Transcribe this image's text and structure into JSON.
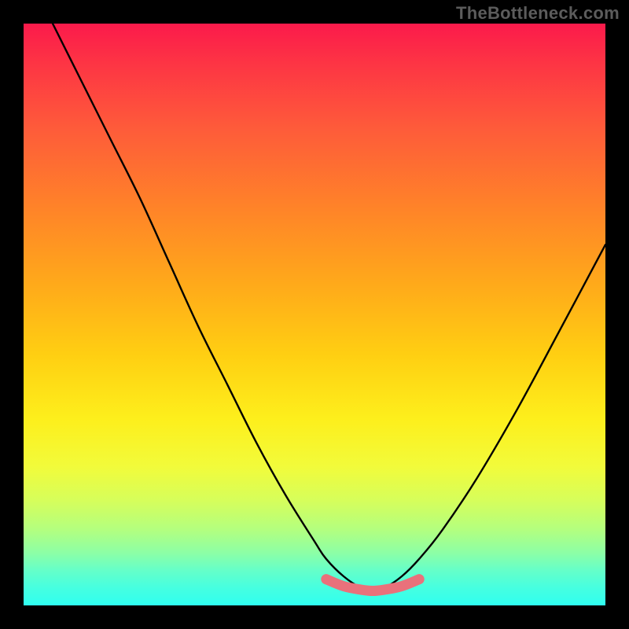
{
  "watermark": "TheBottleneck.com",
  "chart_data": {
    "type": "line",
    "title": "",
    "xlabel": "",
    "ylabel": "",
    "xlim": [
      0,
      100
    ],
    "ylim": [
      0,
      100
    ],
    "grid": false,
    "series": [
      {
        "name": "bottleneck-curve",
        "x": [
          5,
          10,
          15,
          20,
          25,
          30,
          35,
          40,
          45,
          50,
          52,
          55,
          58,
          60,
          62,
          65,
          68,
          72,
          78,
          85,
          92,
          100
        ],
        "values": [
          100,
          90,
          80,
          70,
          59,
          48,
          38,
          28,
          19,
          11,
          8,
          5,
          3,
          2.5,
          3,
          5,
          8,
          13,
          22,
          34,
          47,
          62
        ]
      },
      {
        "name": "optimal-zone",
        "x": [
          52,
          55,
          58,
          60,
          62,
          65,
          68
        ],
        "values": [
          4.5,
          3.3,
          2.7,
          2.5,
          2.7,
          3.3,
          4.5
        ]
      }
    ],
    "gradient_stops": [
      {
        "pos": 0,
        "color": "#fb1a4b"
      },
      {
        "pos": 7,
        "color": "#fd3544"
      },
      {
        "pos": 18,
        "color": "#fe5b3a"
      },
      {
        "pos": 32,
        "color": "#ff8428"
      },
      {
        "pos": 45,
        "color": "#ffaa1a"
      },
      {
        "pos": 57,
        "color": "#ffcf12"
      },
      {
        "pos": 68,
        "color": "#fdef1c"
      },
      {
        "pos": 76,
        "color": "#f2fb3a"
      },
      {
        "pos": 82,
        "color": "#d6fe5b"
      },
      {
        "pos": 87,
        "color": "#b3ff7f"
      },
      {
        "pos": 91,
        "color": "#8cffa6"
      },
      {
        "pos": 94,
        "color": "#65ffc9"
      },
      {
        "pos": 97,
        "color": "#46ffe0"
      },
      {
        "pos": 100,
        "color": "#2ffff0"
      }
    ],
    "optimal_zone_color": "#e9717b",
    "curve_color": "#000000"
  }
}
